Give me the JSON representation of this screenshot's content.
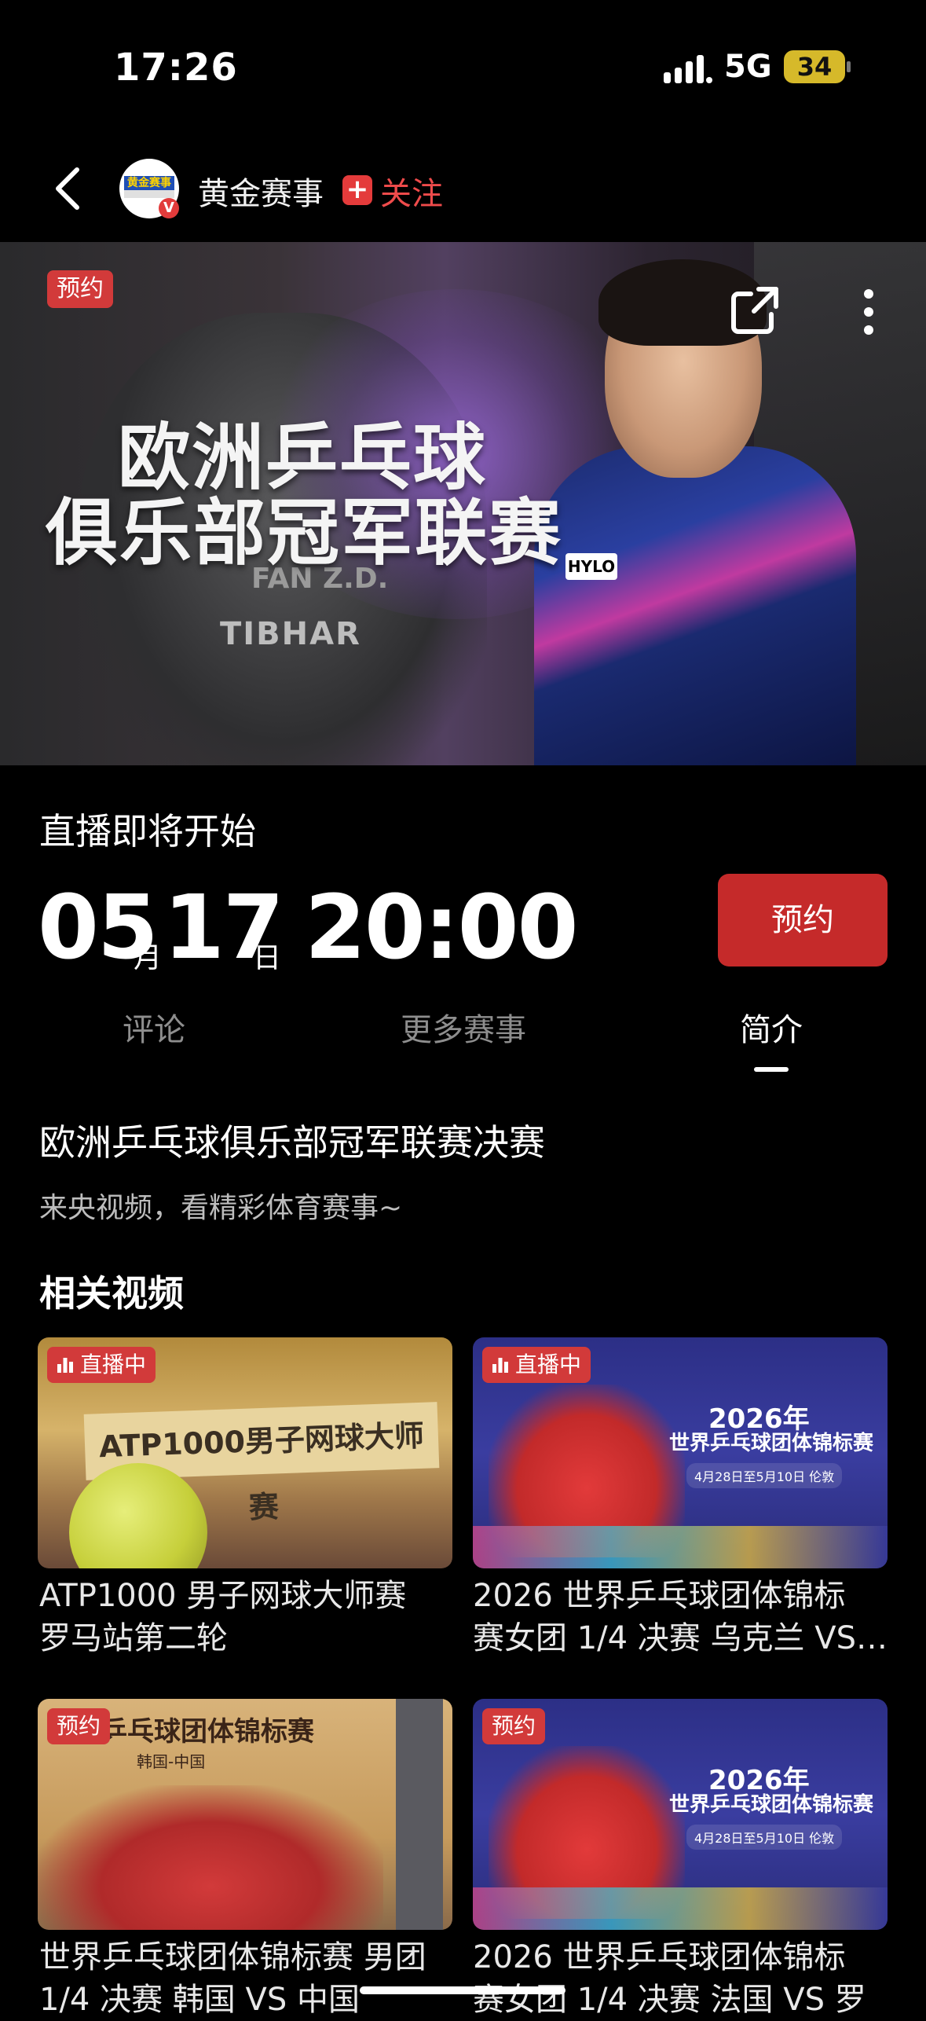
{
  "status_bar": {
    "time": "17:26",
    "network": "5G",
    "battery": "34"
  },
  "nav": {
    "channel_name": "黄金赛事",
    "follow_label": "关注",
    "avatar_text": "黄金赛事",
    "verified_mark": "V"
  },
  "hero": {
    "badge": "预约",
    "title_line1": "欧洲乒乓球",
    "title_line2": "俱乐部冠军联赛",
    "jersey_name": "FAN Z.D.",
    "jersey_brand": "TIBHAR",
    "shirt_sponsor": "HYLO"
  },
  "live": {
    "label": "直播即将开始",
    "month": "05",
    "month_unit": "月",
    "day": "17",
    "day_unit": "日",
    "time": "20:00",
    "reserve_button": "预约"
  },
  "tabs": [
    {
      "label": "评论",
      "active": false
    },
    {
      "label": "更多赛事",
      "active": false
    },
    {
      "label": "简介",
      "active": true
    }
  ],
  "intro": {
    "title": "欧洲乒乓球俱乐部冠军联赛决赛",
    "subtitle": "来央视频，看精彩体育赛事~"
  },
  "related": {
    "heading": "相关视频",
    "items": [
      {
        "badge": "直播中",
        "thumb_text": "ATP1000男子网球大师赛",
        "title_l1": "ATP1000 男子网球大师赛",
        "title_l2": "罗马站第二轮"
      },
      {
        "badge": "直播中",
        "thumb_year": "2026年",
        "thumb_text": "世界乒乓球团体锦标赛",
        "thumb_date": "4月28日至5月10日 伦敦",
        "title_l1": "2026 世界乒乓球团体锦标",
        "title_l2": "赛女团 1/4 决赛 乌克兰 VS…"
      },
      {
        "badge": "预约",
        "thumb_text": "乒乓球团体锦标赛",
        "thumb_vs": "韩国-中国",
        "title_l1": "世界乒乓球团体锦标赛 男团",
        "title_l2": "1/4 决赛 韩国 VS 中国"
      },
      {
        "badge": "预约",
        "thumb_year": "2026年",
        "thumb_text": "世界乒乓球团体锦标赛",
        "thumb_date": "4月28日至5月10日 伦敦",
        "title_l1": "2026 世界乒乓球团体锦标",
        "title_l2": "赛女团 1/4 决赛 法国 VS 罗"
      }
    ]
  },
  "colors": {
    "accent_red": "#c52a2a",
    "follow_red": "#ef4b4b",
    "background": "#000000"
  }
}
